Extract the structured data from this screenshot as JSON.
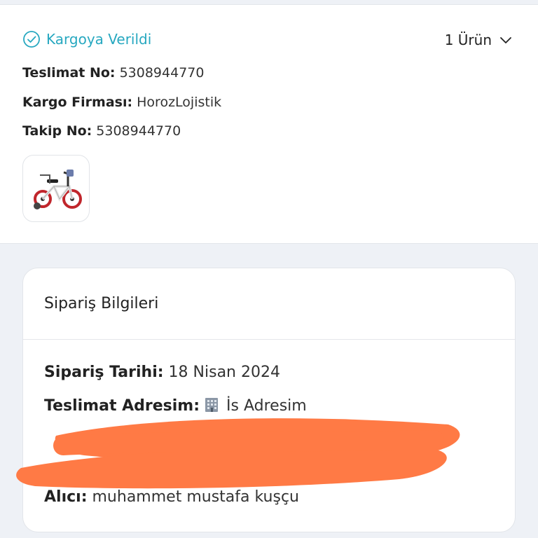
{
  "shipment": {
    "status": "Kargoya Verildi",
    "product_count": "1 Ürün",
    "delivery_no_label": "Teslimat No:",
    "delivery_no": "5308944770",
    "carrier_label": "Kargo Firması:",
    "carrier": "HorozLojistik",
    "tracking_label": "Takip No:",
    "tracking_no": "5308944770",
    "status_color": "#27a8c0",
    "icons": [
      "check-circle-icon",
      "chevron-down-icon"
    ]
  },
  "order_info": {
    "title": "Sipariş Bilgileri",
    "order_date_label": "Sipariş Tarihi:",
    "order_date": "18 Nisan 2024",
    "address_label": "Teslimat Adresim:",
    "address_name": "İs Adresim",
    "recipient_label": "Alıcı:",
    "recipient": "muhammet mustafa kuşçu"
  },
  "colors": {
    "page_bg": "#eef1f6",
    "redaction": "#ff7a45"
  }
}
